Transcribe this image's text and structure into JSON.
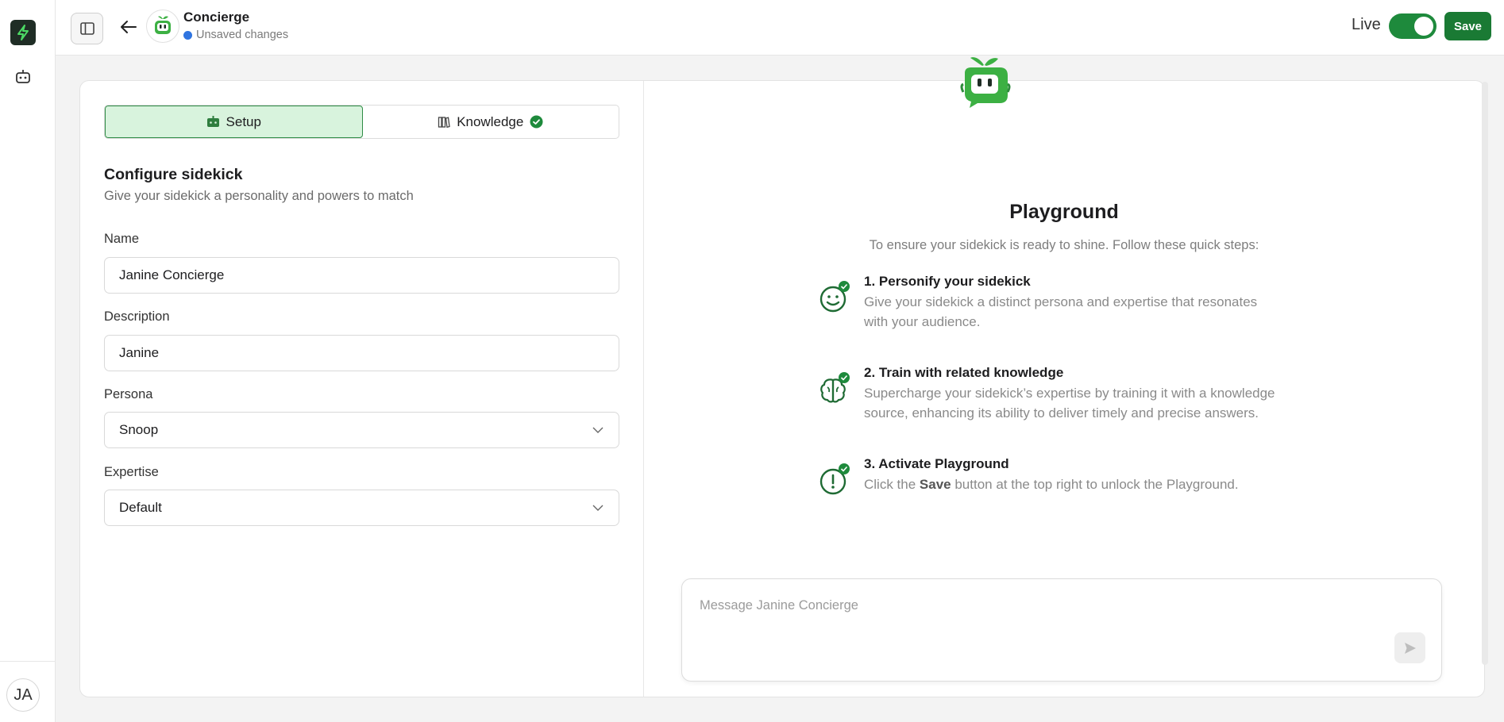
{
  "rail": {
    "user_initials": "JA"
  },
  "topbar": {
    "agent_name": "Concierge",
    "status_text": "Unsaved changes",
    "live_label": "Live",
    "live_enabled": true,
    "save_label": "Save"
  },
  "tabs": [
    {
      "label": "Setup",
      "icon": "bot-icon",
      "active": true
    },
    {
      "label": "Knowledge",
      "icon": "books-icon",
      "active": false,
      "complete": true
    }
  ],
  "setup": {
    "title": "Configure sidekick",
    "subtitle": "Give your sidekick a personality and powers to match",
    "fields": {
      "name": {
        "label": "Name",
        "value": "Janine Concierge"
      },
      "description": {
        "label": "Description",
        "value": "Janine"
      },
      "persona": {
        "label": "Persona",
        "value": "Snoop"
      },
      "expertise": {
        "label": "Expertise",
        "value": "Default"
      }
    }
  },
  "playground": {
    "title": "Playground",
    "subtitle": "To ensure your sidekick is ready to shine. Follow these quick steps:",
    "steps": [
      {
        "title": "1. Personify your sidekick",
        "description": "Give your sidekick a distinct persona and expertise that resonates with your audience.",
        "icon": "smile-icon",
        "done": true
      },
      {
        "title": "2. Train with related knowledge",
        "description": "Supercharge your sidekick’s expertise by training it with a knowledge source, enhancing its ability to deliver timely and precise answers.",
        "icon": "brain-icon",
        "done": true
      },
      {
        "title": "3. Activate Playground",
        "description_pre": "Click the ",
        "description_bold": "Save",
        "description_post": " button at the top right to unlock the Playground.",
        "icon": "alert-icon",
        "done": true
      }
    ],
    "message_placeholder": "Message Janine Concierge"
  },
  "colors": {
    "brand_green": "#1a7a34",
    "active_tab_bg": "#d8f3dd",
    "status_blue": "#2f74e0"
  }
}
